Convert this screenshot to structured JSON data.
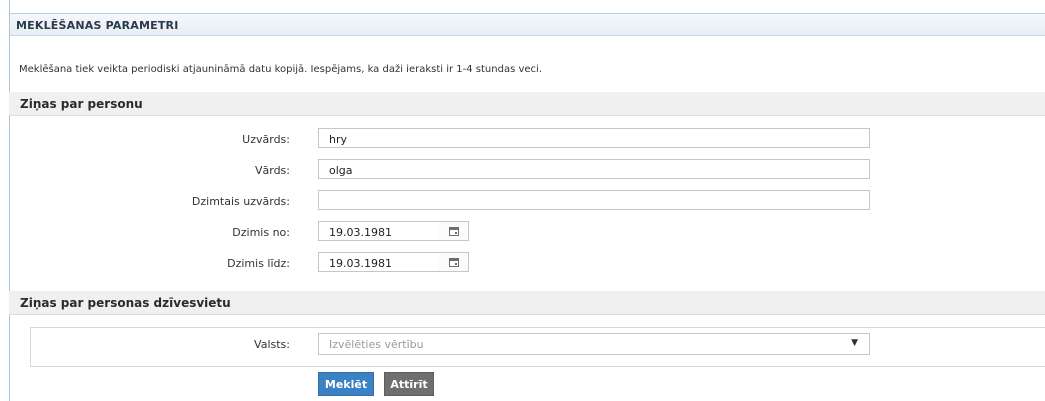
{
  "panel": {
    "title": "MEKLĒŠANAS PARAMETRI"
  },
  "notice": "Meklēšana tiek veikta periodiski atjaunināmā datu kopijā. Iespējams, ka daži ieraksti ir 1-4 stundas veci.",
  "sections": {
    "person": {
      "title": "Ziņas par personu"
    },
    "residence": {
      "title": "Ziņas par personas dzīvesvietu"
    }
  },
  "form": {
    "surname": {
      "label": "Uzvārds:",
      "value": "hry"
    },
    "name": {
      "label": "Vārds:",
      "value": "olga"
    },
    "birth_surname": {
      "label": "Dzimtais uzvārds:",
      "value": ""
    },
    "born_from": {
      "label": "Dzimis no:",
      "value": "19.03.1981"
    },
    "born_to": {
      "label": "Dzimis līdz:",
      "value": "19.03.1981"
    },
    "country": {
      "label": "Valsts:",
      "placeholder": "Izvēlēties vērtību"
    }
  },
  "buttons": {
    "search": "Meklēt",
    "clear": "Attīrīt"
  },
  "icons": {
    "calendar": "calendar-icon",
    "dropdown": "triangle-down"
  },
  "colors": {
    "primary_button": "#3a82c4",
    "secondary_button": "#6f6f6f"
  }
}
